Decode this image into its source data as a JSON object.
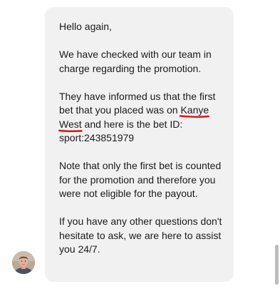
{
  "message": {
    "greeting": "Hello again,",
    "line_checked": "We have checked with our team in charge regarding the promotion.",
    "informed_before": "They have informed us that the first bet that you placed was on ",
    "informed_highlight_1": "Kanye",
    "informed_space": " ",
    "informed_highlight_2": "West",
    "informed_after": " and here is the bet ID:",
    "bet_id": "sport:243851979",
    "note": "Note that only the first bet is counted for the promotion and therefore you were not eligible for the payout.",
    "closing": "If you have any other questions don't hesitate to ask, we are here to assist you 24/7."
  },
  "avatar": {
    "icon": "agent-avatar-photo"
  },
  "colors": {
    "bubble_background": "#f1f1f1",
    "text": "#1b1b1b",
    "annotation_red": "#d4141c",
    "scrollbar_thumb": "#bcbcbc"
  }
}
